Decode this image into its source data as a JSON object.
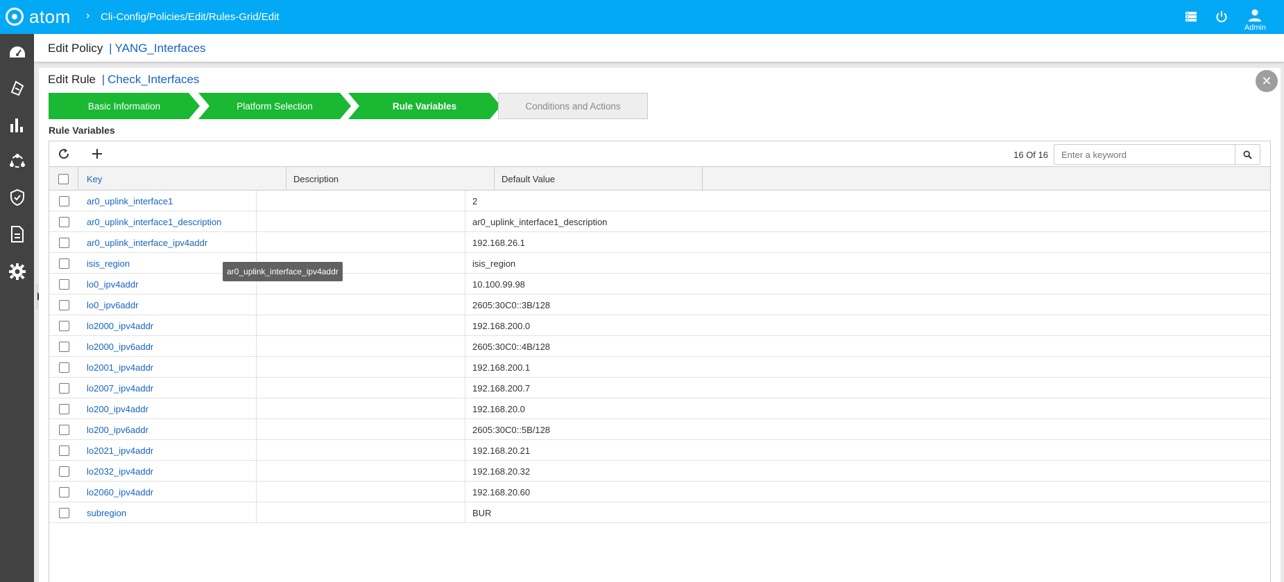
{
  "app": {
    "logo_text": "atom",
    "breadcrumb": "Cli-Config/Policies/Edit/Rules-Grid/Edit",
    "user_label": "Admin",
    "colors": {
      "topbar": "#03a9f4",
      "sidenav": "#424242",
      "step_done": "#1ab833",
      "link": "#1565c0"
    }
  },
  "header": {
    "prefix": "Edit Policy",
    "separator": "|",
    "policy_name": "YANG_Interfaces"
  },
  "rule": {
    "prefix": "Edit Rule",
    "separator": "|",
    "rule_name": "Check_Interfaces"
  },
  "steps": [
    {
      "label": "Basic Information",
      "state": "done"
    },
    {
      "label": "Platform Selection",
      "state": "done"
    },
    {
      "label": "Rule Variables",
      "state": "active"
    },
    {
      "label": "Conditions and Actions",
      "state": "pending"
    }
  ],
  "section_label": "Rule Variables",
  "grid": {
    "count": "16 Of 16",
    "search_placeholder": "Enter a keyword",
    "columns": {
      "key": "Key",
      "description": "Description",
      "default_value": "Default Value"
    },
    "rows": [
      {
        "key": "ar0_uplink_interface1",
        "description": "",
        "default_value": "2"
      },
      {
        "key": "ar0_uplink_interface1_description",
        "description": "",
        "default_value": "ar0_uplink_interface1_description"
      },
      {
        "key": "ar0_uplink_interface_ipv4addr",
        "description": "",
        "default_value": "192.168.26.1"
      },
      {
        "key": "isis_region",
        "description": "",
        "default_value": "isis_region"
      },
      {
        "key": "lo0_ipv4addr",
        "description": "",
        "default_value": "10.100.99.98"
      },
      {
        "key": "lo0_ipv6addr",
        "description": "",
        "default_value": "2605:30C0::3B/128"
      },
      {
        "key": "lo2000_ipv4addr",
        "description": "",
        "default_value": "192.168.200.0"
      },
      {
        "key": "lo2000_ipv6addr",
        "description": "",
        "default_value": "2605:30C0::4B/128"
      },
      {
        "key": "lo2001_ipv4addr",
        "description": "",
        "default_value": "192.168.200.1"
      },
      {
        "key": "lo2007_ipv4addr",
        "description": "",
        "default_value": "192.168.200.7"
      },
      {
        "key": "lo200_ipv4addr",
        "description": "",
        "default_value": "192.168.20.0"
      },
      {
        "key": "lo200_ipv6addr",
        "description": "",
        "default_value": "2605:30C0::5B/128"
      },
      {
        "key": "lo2021_ipv4addr",
        "description": "",
        "default_value": "192.168.20.21"
      },
      {
        "key": "lo2032_ipv4addr",
        "description": "",
        "default_value": "192.168.20.32"
      },
      {
        "key": "lo2060_ipv4addr",
        "description": "",
        "default_value": "192.168.20.60"
      },
      {
        "key": "subregion",
        "description": "",
        "default_value": "BUR"
      }
    ]
  },
  "tooltip": "ar0_uplink_interface_ipv4addr"
}
